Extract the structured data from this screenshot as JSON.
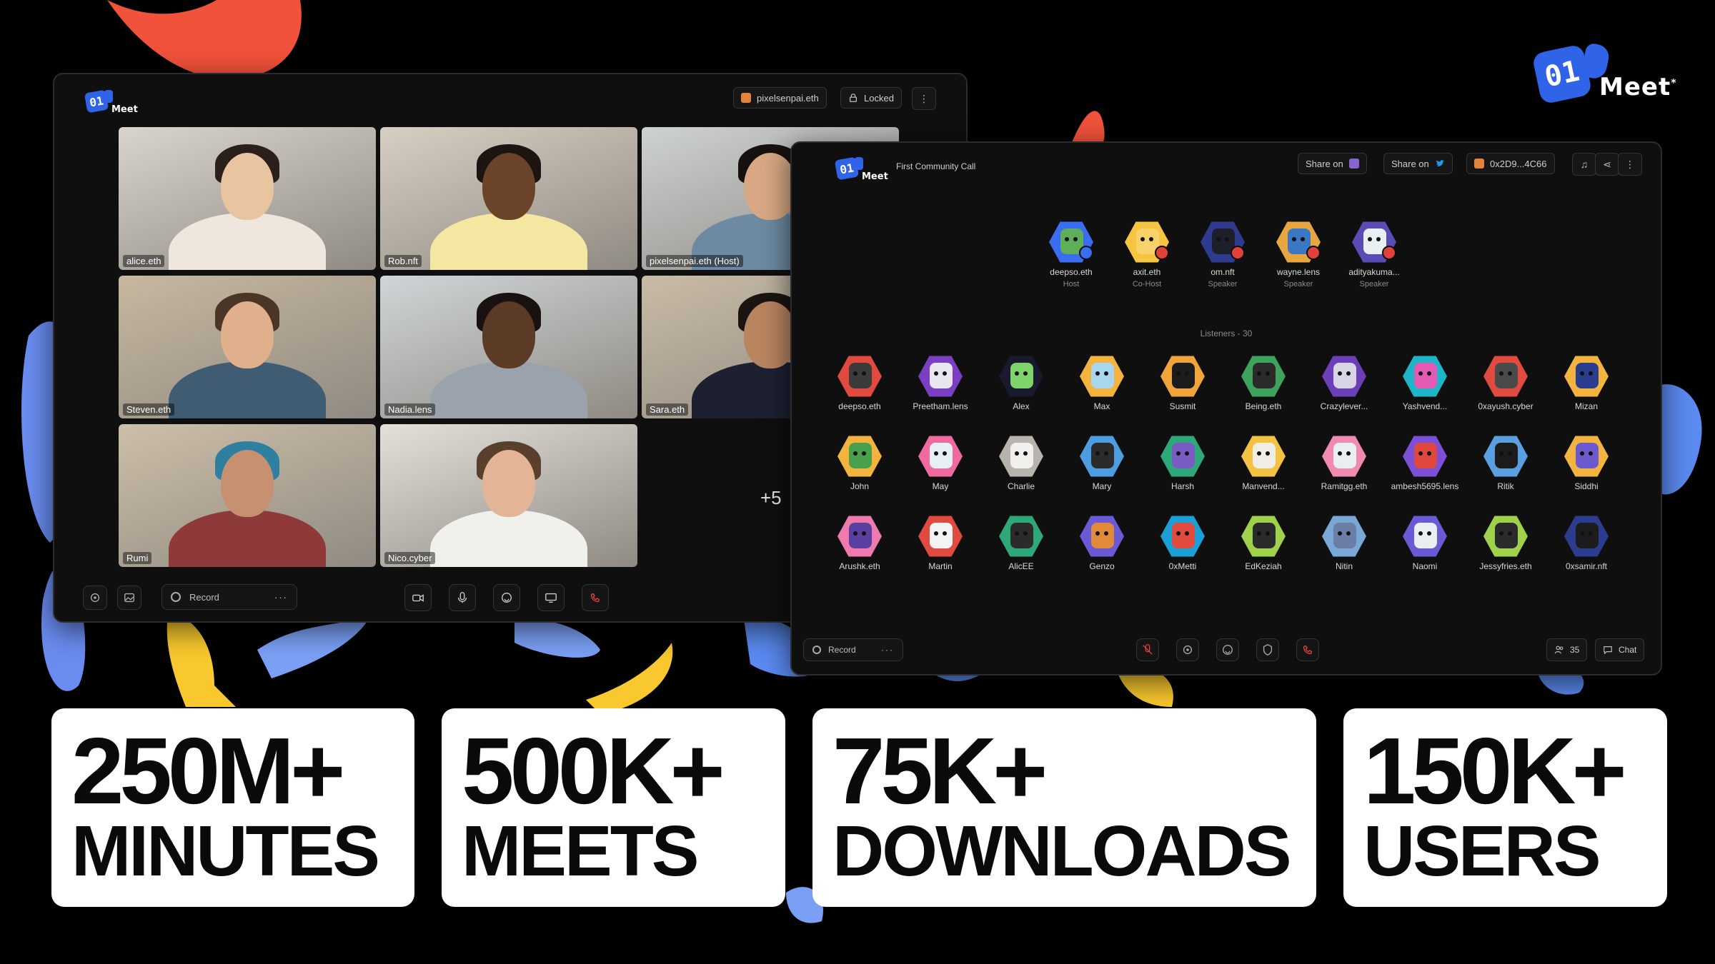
{
  "brand": {
    "logo_text": "01",
    "word": "Meet",
    "mark": "*"
  },
  "video_window": {
    "logo_text": "01",
    "logo_word": "Meet",
    "user_chip": "pixelsenpai.eth",
    "lock_chip": "Locked",
    "tiles": [
      {
        "name": "alice.eth",
        "bg": "#d9d4cc",
        "skin": "#e8c4a0",
        "hair": "#2b1f1a",
        "shirt": "#efe7dd"
      },
      {
        "name": "Rob.nft",
        "bg": "#d8cfc3",
        "skin": "#6b4329",
        "hair": "#1c1410",
        "shirt": "#f3e7a1"
      },
      {
        "name": "pixelsenpai.eth (Host)",
        "bg": "#cdd2d3",
        "skin": "#d7a883",
        "hair": "#16110e",
        "shirt": "#6c8aa1"
      },
      {
        "name": "Steven.eth",
        "bg": "#c7b89f",
        "skin": "#e0b08c",
        "hair": "#4a3526",
        "shirt": "#3f5c73"
      },
      {
        "name": "Nadia.lens",
        "bg": "#cfd6d8",
        "skin": "#5b3a26",
        "hair": "#1a1210",
        "shirt": "#9aa3ad"
      },
      {
        "name": "Sara.eth",
        "bg": "#c9bba6",
        "skin": "#b98460",
        "hair": "#1b1410",
        "shirt": "#1c2030"
      },
      {
        "name": "Rumi",
        "bg": "#cdbfa8",
        "skin": "#c69071",
        "hair": "#2f7fa1",
        "shirt": "#8f3a3a"
      },
      {
        "name": "Nico.cyber",
        "bg": "#e3e0da",
        "skin": "#e3b596",
        "hair": "#5a3f2c",
        "shirt": "#f0f0ec"
      }
    ],
    "overflow_count": "+5",
    "record_label": "Record"
  },
  "audio_window": {
    "logo_text": "01",
    "logo_word": "Meet",
    "title": "First Community Call",
    "share1_label": "Share on",
    "share2_label": "Share on",
    "wallet_label": "0x2D9...4C66",
    "speakers": [
      {
        "name": "deepso.eth",
        "role": "Host",
        "hex": "#3a6df0",
        "face": "#5fae5a"
      },
      {
        "name": "axit.eth",
        "role": "Co-Host",
        "hex": "#f5c542",
        "face": "#f7d26a"
      },
      {
        "name": "om.nft",
        "role": "Speaker",
        "hex": "#2e3b8f",
        "face": "#1f1f2b"
      },
      {
        "name": "wayne.lens",
        "role": "Speaker",
        "hex": "#e8a640",
        "face": "#3b78c4"
      },
      {
        "name": "adityakuma...",
        "role": "Speaker",
        "hex": "#5b4bb5",
        "face": "#e9f0f4"
      }
    ],
    "listeners_label": "Listeners - 30",
    "listeners": [
      {
        "name": "deepso.eth",
        "hex": "#e04a3f",
        "face": "#3b3b3b"
      },
      {
        "name": "Preetham.lens",
        "hex": "#7b3fc4",
        "face": "#e9e6ef"
      },
      {
        "name": "Alex",
        "hex": "#1a1a2e",
        "face": "#7fd36a"
      },
      {
        "name": "Max",
        "hex": "#f3b33f",
        "face": "#a9d6ef"
      },
      {
        "name": "Susmit",
        "hex": "#f0a43a",
        "face": "#1c1c1c"
      },
      {
        "name": "Being.eth",
        "hex": "#3da35d",
        "face": "#2b2b2b"
      },
      {
        "name": "Crazylever...",
        "hex": "#6a3fb8",
        "face": "#d9d3e6"
      },
      {
        "name": "Yashvend...",
        "hex": "#1fb5c9",
        "face": "#e35ab5"
      },
      {
        "name": "0xayush.cyber",
        "hex": "#e04a3f",
        "face": "#4a4a4a"
      },
      {
        "name": "Mizan",
        "hex": "#f3b33f",
        "face": "#2a3d8f"
      },
      {
        "name": "John",
        "hex": "#f3b33f",
        "face": "#4aa04a"
      },
      {
        "name": "May",
        "hex": "#f06aa0",
        "face": "#e8eef6"
      },
      {
        "name": "Charlie",
        "hex": "#b9b3ad",
        "face": "#f2f0ec"
      },
      {
        "name": "Mary",
        "hex": "#4d9de0",
        "face": "#2b2b2b"
      },
      {
        "name": "Harsh",
        "hex": "#2ea878",
        "face": "#7a5bc4"
      },
      {
        "name": "Manvend...",
        "hex": "#f3c242",
        "face": "#f0ede4"
      },
      {
        "name": "Ramitgg.eth",
        "hex": "#f08ab0",
        "face": "#e9eef3"
      },
      {
        "name": "ambesh5695.lens",
        "hex": "#7b4fd6",
        "face": "#e0483e"
      },
      {
        "name": "Ritik",
        "hex": "#5aa0e0",
        "face": "#1c1c1c"
      },
      {
        "name": "Siddhi",
        "hex": "#f3b33f",
        "face": "#6a5acd"
      },
      {
        "name": "Arushk.eth",
        "hex": "#f07ab0",
        "face": "#5a3fa0"
      },
      {
        "name": "Martin",
        "hex": "#e04a3f",
        "face": "#f3f3f3"
      },
      {
        "name": "AlicEE",
        "hex": "#2ea878",
        "face": "#2b2b2b"
      },
      {
        "name": "Genzo",
        "hex": "#6a5ad6",
        "face": "#e08a3a"
      },
      {
        "name": "0xMetti",
        "hex": "#1aa0d6",
        "face": "#e04a3f"
      },
      {
        "name": "EdKeziah",
        "hex": "#9fd14a",
        "face": "#2b2b2b"
      },
      {
        "name": "Nitin",
        "hex": "#7aa8d6",
        "face": "#6b7ea8"
      },
      {
        "name": "Naomi",
        "hex": "#6a5ad6",
        "face": "#e9eef3"
      },
      {
        "name": "Jessyfries.eth",
        "hex": "#9fd14a",
        "face": "#2b2b2b"
      },
      {
        "name": "0xsamir.nft",
        "hex": "#2a3d8f",
        "face": "#1c1c1c"
      }
    ],
    "record_label": "Record",
    "participants_count": "35",
    "chat_label": "Chat"
  },
  "stats": [
    {
      "value": "250M+",
      "label": "MINUTES"
    },
    {
      "value": "500K+",
      "label": "MEETS"
    },
    {
      "value": "75K+",
      "label": "DOWNLOADS"
    },
    {
      "value": "150K+",
      "label": "USERS"
    }
  ],
  "colors": {
    "brand_blue": "#2f63e8",
    "blob_orange": "#f0523a",
    "blob_blue": "#7aa0f5",
    "blob_yellow": "#f8c82e",
    "alert_red": "#e0423a"
  }
}
